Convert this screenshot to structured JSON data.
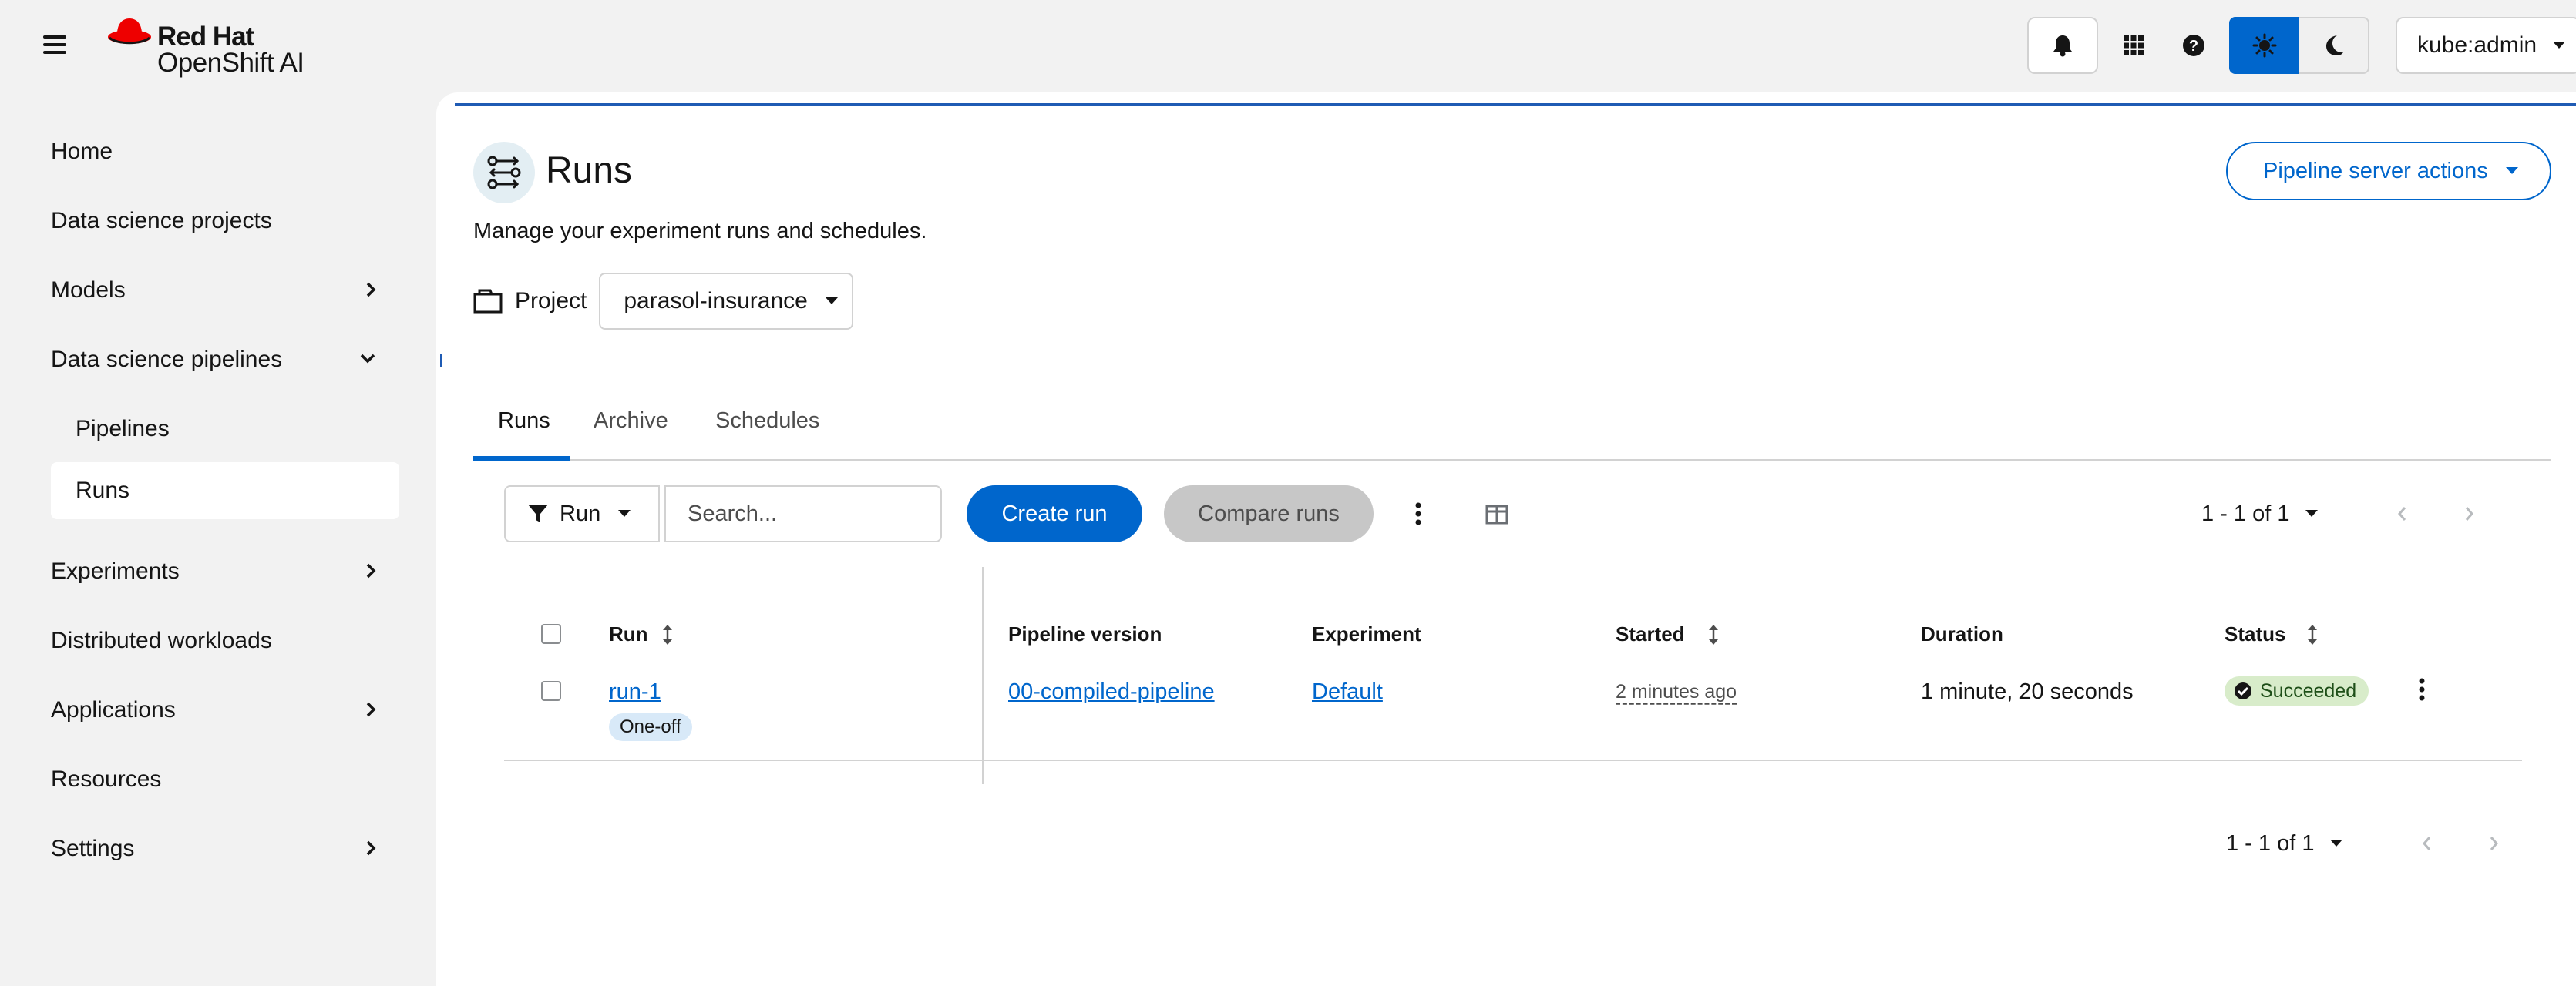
{
  "masthead": {
    "brand_line1": "Red Hat",
    "brand_line2": "OpenShift AI",
    "user_label": "kube:admin",
    "accent": "#0066cc",
    "brand_red": "#ee0000"
  },
  "sidebar": {
    "items": [
      {
        "label": "Home"
      },
      {
        "label": "Data science projects"
      },
      {
        "label": "Models"
      },
      {
        "label": "Data science pipelines"
      },
      {
        "label": "Pipelines"
      },
      {
        "label": "Runs"
      },
      {
        "label": "Experiments"
      },
      {
        "label": "Distributed workloads"
      },
      {
        "label": "Applications"
      },
      {
        "label": "Resources"
      },
      {
        "label": "Settings"
      }
    ]
  },
  "page": {
    "title": "Runs",
    "description": "Manage your experiment runs and schedules.",
    "server_actions_label": "Pipeline server actions",
    "project_label": "Project",
    "project_value": "parasol-insurance"
  },
  "tabs": [
    {
      "label": "Runs"
    },
    {
      "label": "Archive"
    },
    {
      "label": "Schedules"
    }
  ],
  "toolbar": {
    "filter_label": "Run",
    "search_placeholder": "Search...",
    "create_label": "Create run",
    "compare_label": "Compare runs",
    "pagination_top": "1 - 1 of 1",
    "pagination_bottom": "1 - 1 of 1"
  },
  "table": {
    "headers": [
      "Run",
      "Pipeline version",
      "Experiment",
      "Started",
      "Duration",
      "Status"
    ],
    "rows": [
      {
        "run": "run-1",
        "run_type": "One-off",
        "pipeline_version": "00-compiled-pipeline",
        "experiment": "Default",
        "started": "2 minutes ago",
        "duration": "1 minute, 20 seconds",
        "status": "Succeeded"
      }
    ]
  }
}
